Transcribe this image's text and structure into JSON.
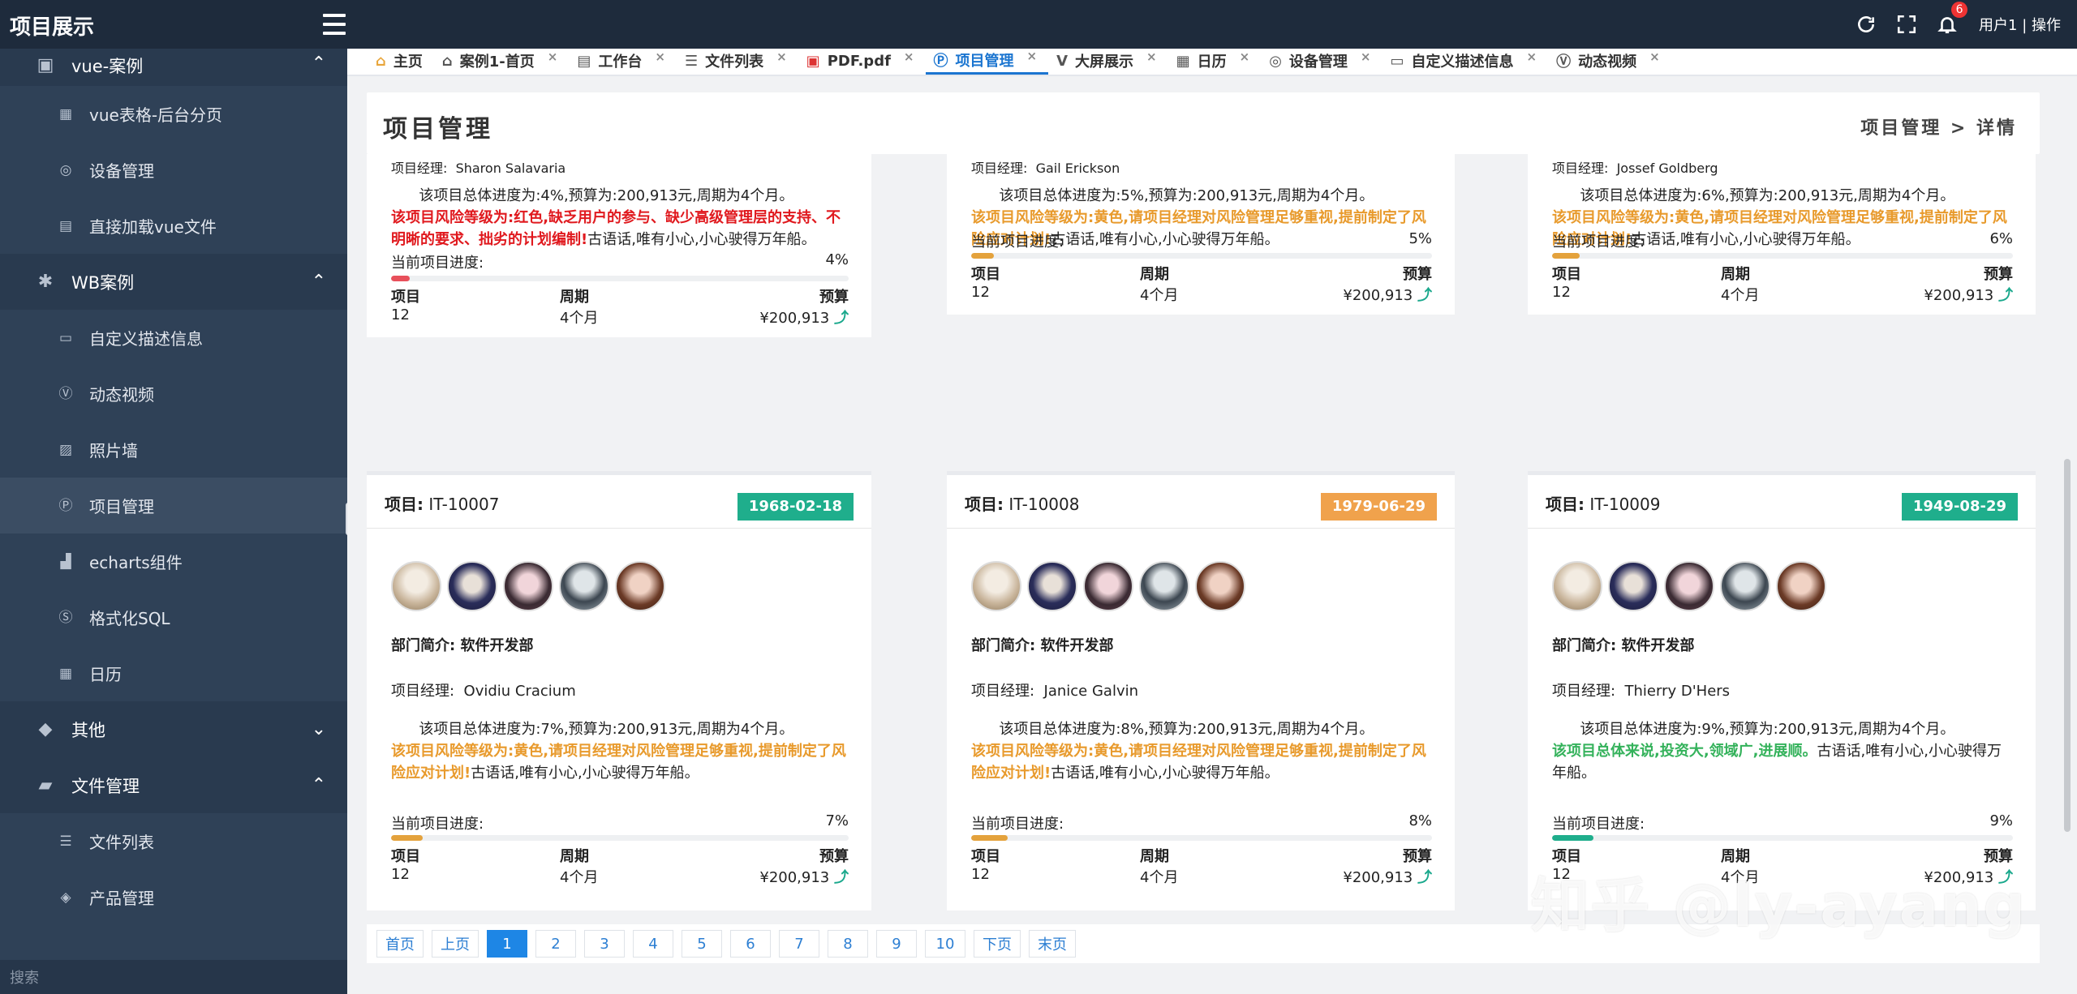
{
  "app": {
    "title": "项目展示"
  },
  "topbar": {
    "notifications": "6",
    "user": "用户1 | 操作"
  },
  "sidebar": {
    "search_placeholder": "搜索",
    "groups": [
      {
        "label": "vue-案例",
        "items": [
          "vue表格-后台分页",
          "设备管理",
          "直接加载vue文件"
        ]
      },
      {
        "label": "WB案例",
        "items": [
          "自定义描述信息",
          "动态视频",
          "照片墙",
          "项目管理",
          "echarts组件",
          "格式化SQL",
          "日历"
        ]
      },
      {
        "label": "其他",
        "items": []
      },
      {
        "label": "文件管理",
        "items": [
          "文件列表",
          "产品管理"
        ]
      }
    ]
  },
  "tabs": [
    {
      "label": "主页",
      "icon": "home-icon"
    },
    {
      "label": "案例1-首页",
      "icon": "home-icon"
    },
    {
      "label": "工作台",
      "icon": "id-card-icon"
    },
    {
      "label": "文件列表",
      "icon": "list-icon"
    },
    {
      "label": "PDF.pdf",
      "icon": "pdf-icon"
    },
    {
      "label": "项目管理",
      "icon": "p-circle-icon",
      "active": true
    },
    {
      "label": "大屏展示",
      "icon": "v-icon"
    },
    {
      "label": "日历",
      "icon": "calendar-icon"
    },
    {
      "label": "设备管理",
      "icon": "gamepad-icon"
    },
    {
      "label": "自定义描述信息",
      "icon": "window-icon"
    },
    {
      "label": "动态视频",
      "icon": "v-square-icon"
    }
  ],
  "page": {
    "title": "项目管理",
    "breadcrumb": "项目管理 > 详情"
  },
  "labels": {
    "dept_prefix": "部门简介:",
    "dept": "软件开发部",
    "mgr_prefix": "项目经理:",
    "progress": "当前项目进度:",
    "col_project": "项目",
    "col_period": "周期",
    "col_budget": "预算",
    "project_prefix": "项目:"
  },
  "cards_top": [
    {
      "manager": "Sharon Salavaria",
      "summary": "该项目总体进度为:4%,预算为:200,913元,周期为4个月。",
      "risk": "该项目风险等级为:红色,缺乏用户的参与、缺少高级管理层的支持、不明晰的要求、拙劣的计划编制!",
      "risk_color": "red",
      "tail": "古语话,唯有小心,小心驶得万年船。",
      "progress_text": "4%",
      "progress": 4,
      "project": "12",
      "period": "4个月",
      "budget": "¥200,913"
    },
    {
      "manager": "Gail Erickson",
      "summary": "该项目总体进度为:5%,预算为:200,913元,周期为4个月。",
      "risk": "该项目风险等级为:黄色,请项目经理对风险管理足够重视,提前制定了风险应对计划!",
      "risk_color": "orange",
      "tail": "古语话,唯有小心,小心驶得万年船。",
      "progress_text": "5%",
      "progress": 5,
      "project": "12",
      "period": "4个月",
      "budget": "¥200,913"
    },
    {
      "manager": "Jossef Goldberg",
      "summary": "该项目总体进度为:6%,预算为:200,913元,周期为4个月。",
      "risk": "该项目风险等级为:黄色,请项目经理对风险管理足够重视,提前制定了风险应对计划!",
      "risk_color": "orange",
      "tail": "古语话,唯有小心,小心驶得万年船。",
      "progress_text": "6%",
      "progress": 6,
      "project": "12",
      "period": "4个月",
      "budget": "¥200,913"
    }
  ],
  "cards_bottom": [
    {
      "id": "IT-10007",
      "date": "1968-02-18",
      "date_color": "#1fae8c",
      "manager": "Ovidiu Cracium",
      "summary": "该项目总体进度为:7%,预算为:200,913元,周期为4个月。",
      "risk": "该项目风险等级为:黄色,请项目经理对风险管理足够重视,提前制定了风险应对计划!",
      "risk_color": "orange",
      "tail": "古语话,唯有小心,小心驶得万年船。",
      "progress_text": "7%",
      "progress": 7,
      "project": "12",
      "period": "4个月",
      "budget": "¥200,913"
    },
    {
      "id": "IT-10008",
      "date": "1979-06-29",
      "date_color": "#f0a24c",
      "manager": "Janice Galvin",
      "summary": "该项目总体进度为:8%,预算为:200,913元,周期为4个月。",
      "risk": "该项目风险等级为:黄色,请项目经理对风险管理足够重视,提前制定了风险应对计划!",
      "risk_color": "orange",
      "tail": "古语话,唯有小心,小心驶得万年船。",
      "progress_text": "8%",
      "progress": 8,
      "project": "12",
      "period": "4个月",
      "budget": "¥200,913"
    },
    {
      "id": "IT-10009",
      "date": "1949-08-29",
      "date_color": "#1fae8c",
      "manager": "Thierry D'Hers",
      "summary": "该项目总体进度为:9%,预算为:200,913元,周期为4个月。",
      "risk": "该项目总体来说,投资大,领域广,进展顺。",
      "risk_color": "green",
      "tail": "古语话,唯有小心,小心驶得万年船。",
      "progress_text": "9%",
      "progress": 9,
      "project": "12",
      "period": "4个月",
      "budget": "¥200,913"
    }
  ],
  "pagination": [
    "首页",
    "上页",
    "1",
    "2",
    "3",
    "4",
    "5",
    "6",
    "7",
    "8",
    "9",
    "10",
    "下页",
    "末页"
  ],
  "pagination_active": "1",
  "watermark": "知乎 @ly-ayang",
  "colors": {
    "red": "#e0191e",
    "orange": "#e89a2c",
    "green": "#34b25b",
    "teal": "#1fae8c",
    "bar_red": "#e8505b",
    "bar_orange": "#e4a23c",
    "bar_teal": "#1fae8c",
    "accent": "#1e86e5"
  }
}
